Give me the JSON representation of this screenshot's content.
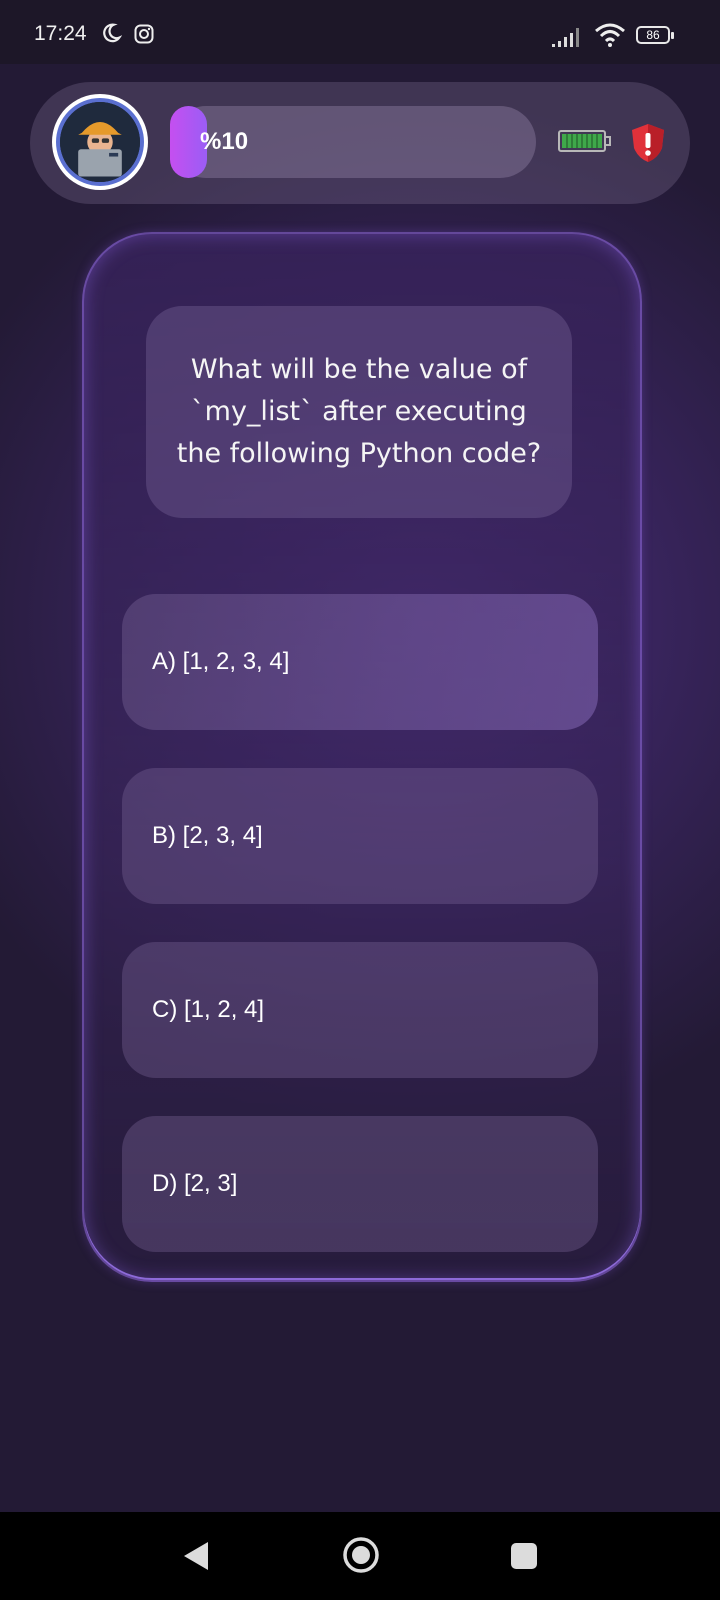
{
  "status_bar": {
    "time": "17:24",
    "battery": "86",
    "icons": [
      "moon-icon",
      "instagram-icon",
      "signal-icon",
      "wifi-icon",
      "battery-icon"
    ]
  },
  "header": {
    "avatar": "avatar",
    "progress_label": "%10",
    "progress_value": 0.1,
    "icons": [
      "battery-power-icon",
      "shield-alert-icon"
    ],
    "colors": {
      "progress": "#b455f2",
      "power": "#3fa84a",
      "shield": "#e0313a"
    }
  },
  "question": {
    "text": "What will be the value of `my_list` after executing the following Python code?"
  },
  "answers": [
    {
      "label": "A) [1, 2, 3, 4]"
    },
    {
      "label": "B) [2, 3, 4]"
    },
    {
      "label": "C) [1, 2, 4]"
    },
    {
      "label": "D) [2, 3]"
    }
  ],
  "nav": {
    "icons": [
      "back-icon",
      "home-icon",
      "recents-icon"
    ]
  }
}
